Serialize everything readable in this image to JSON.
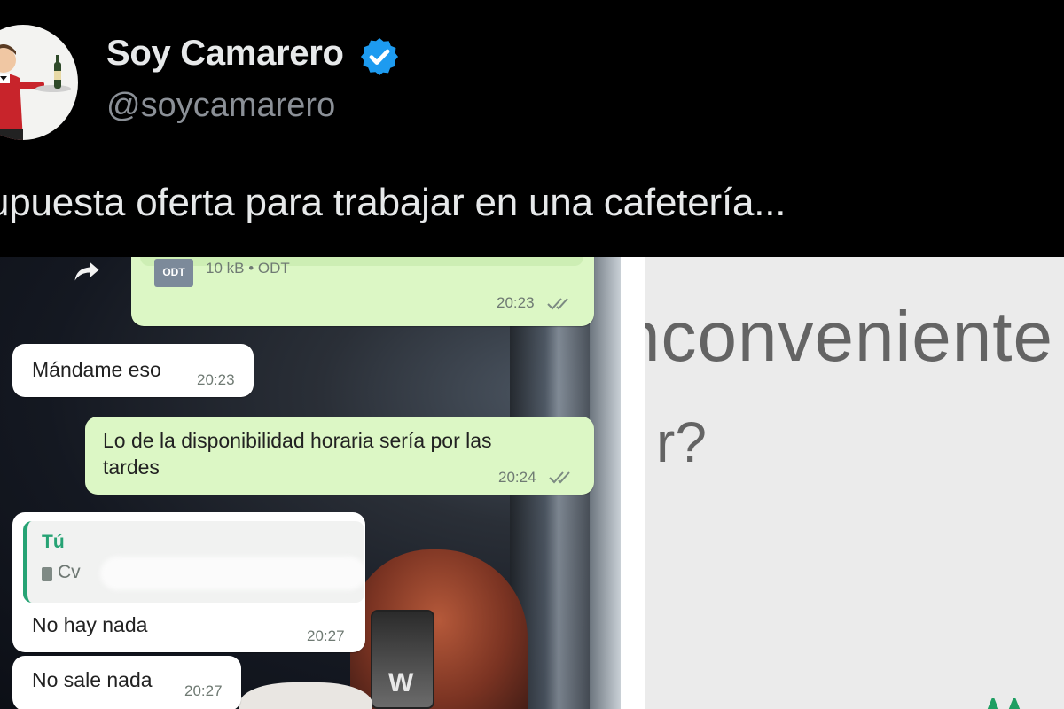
{
  "tweet": {
    "display_name": "Soy Camarero",
    "handle": "@soycamarero",
    "text": "upuesta oferta para trabajar en una cafetería..."
  },
  "chat": {
    "file": {
      "type_badge": "ODT",
      "meta": "10 kB • ODT",
      "time": "20:23"
    },
    "messages": [
      {
        "direction": "incoming",
        "text": "Mándame eso",
        "time": "20:23"
      },
      {
        "direction": "outgoing",
        "text_line1": "Lo de la disponibilidad horaria sería por las",
        "text_line2": "tardes",
        "time": "20:24"
      },
      {
        "direction": "incoming",
        "reply_author": "Tú",
        "reply_file": "Cv",
        "text": "No hay nada",
        "time": "20:27"
      },
      {
        "direction": "incoming",
        "text": "No sale nada",
        "time": "20:27"
      }
    ]
  },
  "right_image": {
    "word": "nconveniente",
    "question_fragment": "r?"
  },
  "colors": {
    "background": "#000000",
    "verified_badge": "#1d9bf0",
    "outgoing_bubble": "#dcf7c5",
    "incoming_bubble": "#ffffff",
    "reply_accent": "#26a374"
  },
  "icons": [
    "verified-badge-icon",
    "forward-icon",
    "double-check-icon",
    "document-icon"
  ]
}
